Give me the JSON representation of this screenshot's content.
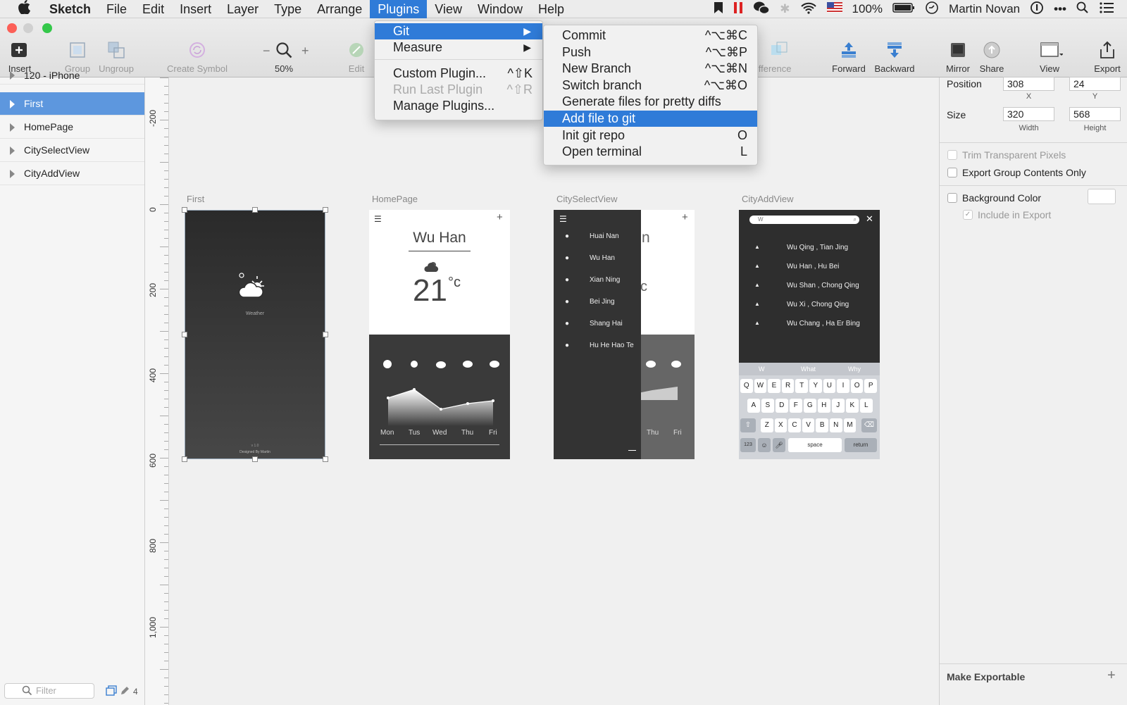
{
  "menubar": {
    "apple": "",
    "items": [
      "Sketch",
      "File",
      "Edit",
      "Insert",
      "Layer",
      "Type",
      "Arrange",
      "Plugins",
      "View",
      "Window",
      "Help"
    ],
    "battery": "100%",
    "user": "Martin Novan"
  },
  "toolbar": {
    "insert": "Insert",
    "group": "Group",
    "ungroup": "Ungroup",
    "create_symbol": "Create Symbol",
    "zoom": "50%",
    "zoom_minus": "−",
    "zoom_plus": "+",
    "edit": "Edit",
    "difference": "Difference",
    "forward": "Forward",
    "backward": "Backward",
    "mirror": "Mirror",
    "share": "Share",
    "view": "View",
    "export": "Export"
  },
  "layers": [
    "120 - iPhone",
    "First",
    "HomePage",
    "CitySelectView",
    "CityAddView"
  ],
  "filter": {
    "placeholder": "Filter",
    "count": "4"
  },
  "ruler": [
    "-200",
    "0",
    "200",
    "400",
    "600",
    "800",
    "1,000"
  ],
  "artboards": {
    "first": {
      "label": "First",
      "brand": "Weather",
      "version": "v 1.0",
      "credit": "Designed By Martin"
    },
    "home": {
      "label": "HomePage",
      "city": "Wu Han",
      "temp": "21",
      "unit": "°c",
      "days": [
        "Mon",
        "Tus",
        "Wed",
        "Thu",
        "Fri"
      ]
    },
    "cityselect": {
      "label": "CitySelectView",
      "cities": [
        "Huai Nan",
        "Wu Han",
        "Xian Ning",
        "Bei Jing",
        "Shang Hai",
        "Hu He Hao Te"
      ],
      "days": [
        "Thu",
        "Fri"
      ],
      "ghost_n": "n",
      "ghost_c": "c"
    },
    "cityadd": {
      "label": "CityAddView",
      "search": "W",
      "results": [
        "Wu Qing , Tian Jing",
        "Wu Han , Hu Bei",
        "Wu Shan , Chong Qing",
        "Wu Xi , Chong Qing",
        "Wu Chang , Ha Er Bing"
      ],
      "suggestions": [
        "W",
        "What",
        "Why"
      ],
      "keys_row1": [
        "Q",
        "W",
        "E",
        "R",
        "T",
        "Y",
        "U",
        "I",
        "O",
        "P"
      ],
      "keys_row2": [
        "A",
        "S",
        "D",
        "F",
        "G",
        "H",
        "J",
        "K",
        "L"
      ],
      "keys_row3": [
        "Z",
        "X",
        "C",
        "V",
        "B",
        "N",
        "M"
      ],
      "num": "123",
      "space": "space",
      "return": "return"
    }
  },
  "inspector": {
    "position_label": "Position",
    "x": "308",
    "y": "24",
    "x_cap": "X",
    "y_cap": "Y",
    "size_label": "Size",
    "width": "320",
    "height": "568",
    "width_cap": "Width",
    "height_cap": "Height",
    "trim": "Trim Transparent Pixels",
    "export_group": "Export Group Contents Only",
    "bg_color": "Background Color",
    "include_export": "Include in Export",
    "make_exportable": "Make Exportable"
  },
  "plugins_menu": {
    "items": [
      {
        "label": "Git",
        "submenu": "▶"
      },
      {
        "label": "Measure",
        "submenu": "▶"
      },
      {
        "label": "Custom Plugin...",
        "shortcut": "^⇧K"
      },
      {
        "label": "Run Last Plugin",
        "shortcut": "^⇧R"
      },
      {
        "label": "Manage Plugins..."
      }
    ]
  },
  "git_menu": {
    "items": [
      {
        "label": "Commit",
        "shortcut": "^⌥⌘C"
      },
      {
        "label": "Push",
        "shortcut": "^⌥⌘P"
      },
      {
        "label": "New Branch",
        "shortcut": "^⌥⌘N"
      },
      {
        "label": "Switch branch",
        "shortcut": "^⌥⌘O"
      },
      {
        "label": "Generate files for pretty diffs",
        "shortcut": ""
      },
      {
        "label": "Add file to git",
        "shortcut": ""
      },
      {
        "label": "Init git repo",
        "shortcut": "O"
      },
      {
        "label": "Open terminal",
        "shortcut": "L"
      }
    ]
  },
  "colors": {
    "accent": "#2f7bd8",
    "selection": "#5d97de",
    "dark_board": "#2c2c2c"
  }
}
